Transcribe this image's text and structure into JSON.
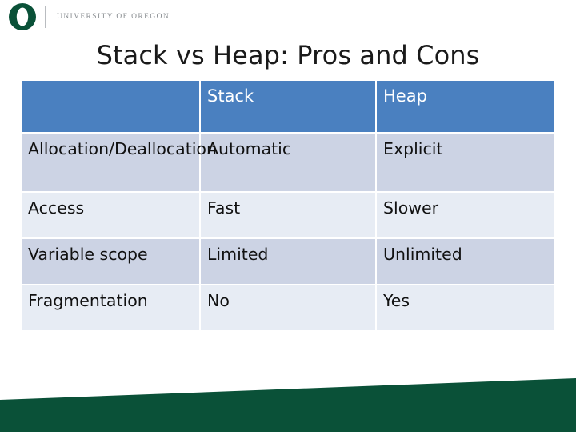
{
  "brand": {
    "logo_icon": "university-of-oregon-o-logo",
    "name": "UNIVERSITY OF OREGON",
    "logo_color": "#0a5138"
  },
  "slide": {
    "title": "Stack vs Heap: Pros and Cons"
  },
  "table": {
    "columns": [
      "",
      "Stack",
      "Heap"
    ],
    "header_bg": "#4a80c0",
    "header_text_color": "#ffffff",
    "band_a_bg": "#ccd3e4",
    "band_b_bg": "#e7ecf4",
    "rows": [
      {
        "feature": "Allocation/Deallocation",
        "stack": "Automatic",
        "heap": "Explicit"
      },
      {
        "feature": "Access",
        "stack": "Fast",
        "heap": "Slower"
      },
      {
        "feature": "Variable scope",
        "stack": "Limited",
        "heap": "Unlimited"
      },
      {
        "feature": "Fragmentation",
        "stack": "No",
        "heap": "Yes"
      }
    ]
  },
  "decoration": {
    "wedge_color": "#0a5138"
  }
}
